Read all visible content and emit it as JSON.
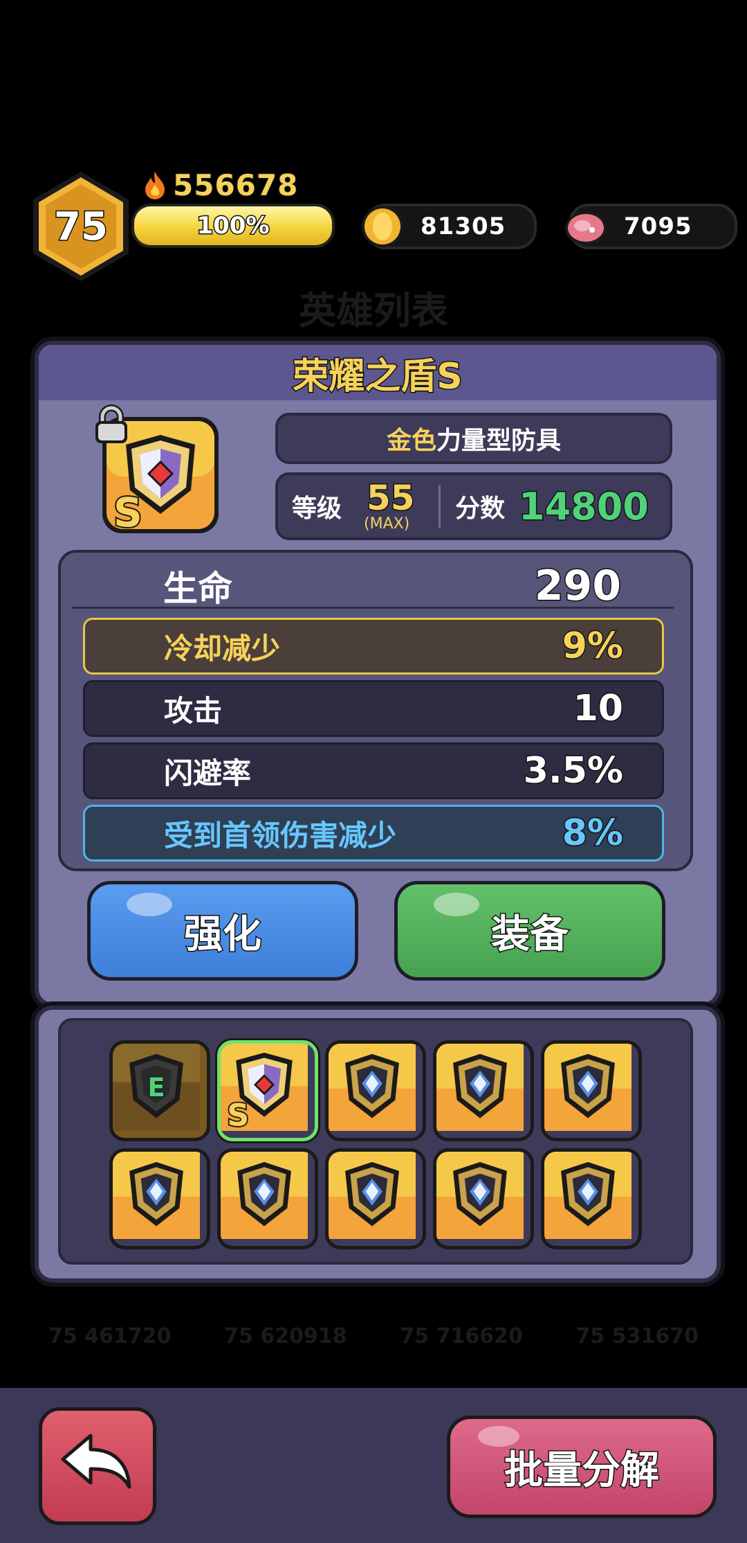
{
  "player": {
    "level": "75",
    "power": "556678",
    "xp_percent_label": "100%",
    "xp_fraction": 1.0
  },
  "resources": {
    "coins": "81305",
    "meat": "7095"
  },
  "background": {
    "title": "英雄列表",
    "hero_stats": [
      "75 461720",
      "75 620918",
      "75 716620",
      "75 531670"
    ]
  },
  "item": {
    "name": "荣耀之盾S",
    "quality": "金色",
    "type": "力量型防具",
    "level_label": "等级",
    "level": "55",
    "level_max": "(MAX)",
    "score_label": "分数",
    "score": "14800",
    "grade_letter": "S"
  },
  "stats": {
    "main": {
      "label": "生命",
      "value": "290"
    },
    "subs": [
      {
        "label": "冷却减少",
        "value": "9%",
        "tier": "gold"
      },
      {
        "label": "攻击",
        "value": "10",
        "tier": "normal"
      },
      {
        "label": "闪避率",
        "value": "3.5%",
        "tier": "normal"
      },
      {
        "label": "受到首领伤害减少",
        "value": "8%",
        "tier": "blue"
      }
    ]
  },
  "buttons": {
    "enhance": "强化",
    "equip": "装备",
    "bulk_decompose": "批量分解"
  },
  "inventory": {
    "slots": [
      {
        "kind": "equipped",
        "letter": "E"
      },
      {
        "kind": "selected",
        "letter": "S"
      },
      {
        "kind": "gem"
      },
      {
        "kind": "gem"
      },
      {
        "kind": "gem"
      },
      {
        "kind": "gem"
      },
      {
        "kind": "gem"
      },
      {
        "kind": "gem"
      },
      {
        "kind": "gem"
      },
      {
        "kind": "gem"
      }
    ]
  },
  "colors": {
    "gold_text": "#f6d25a",
    "score_green": "#4fd27a",
    "blue_text": "#66c7ff",
    "enhance_blue": "#4c8fe6",
    "equip_green": "#52b05c"
  }
}
